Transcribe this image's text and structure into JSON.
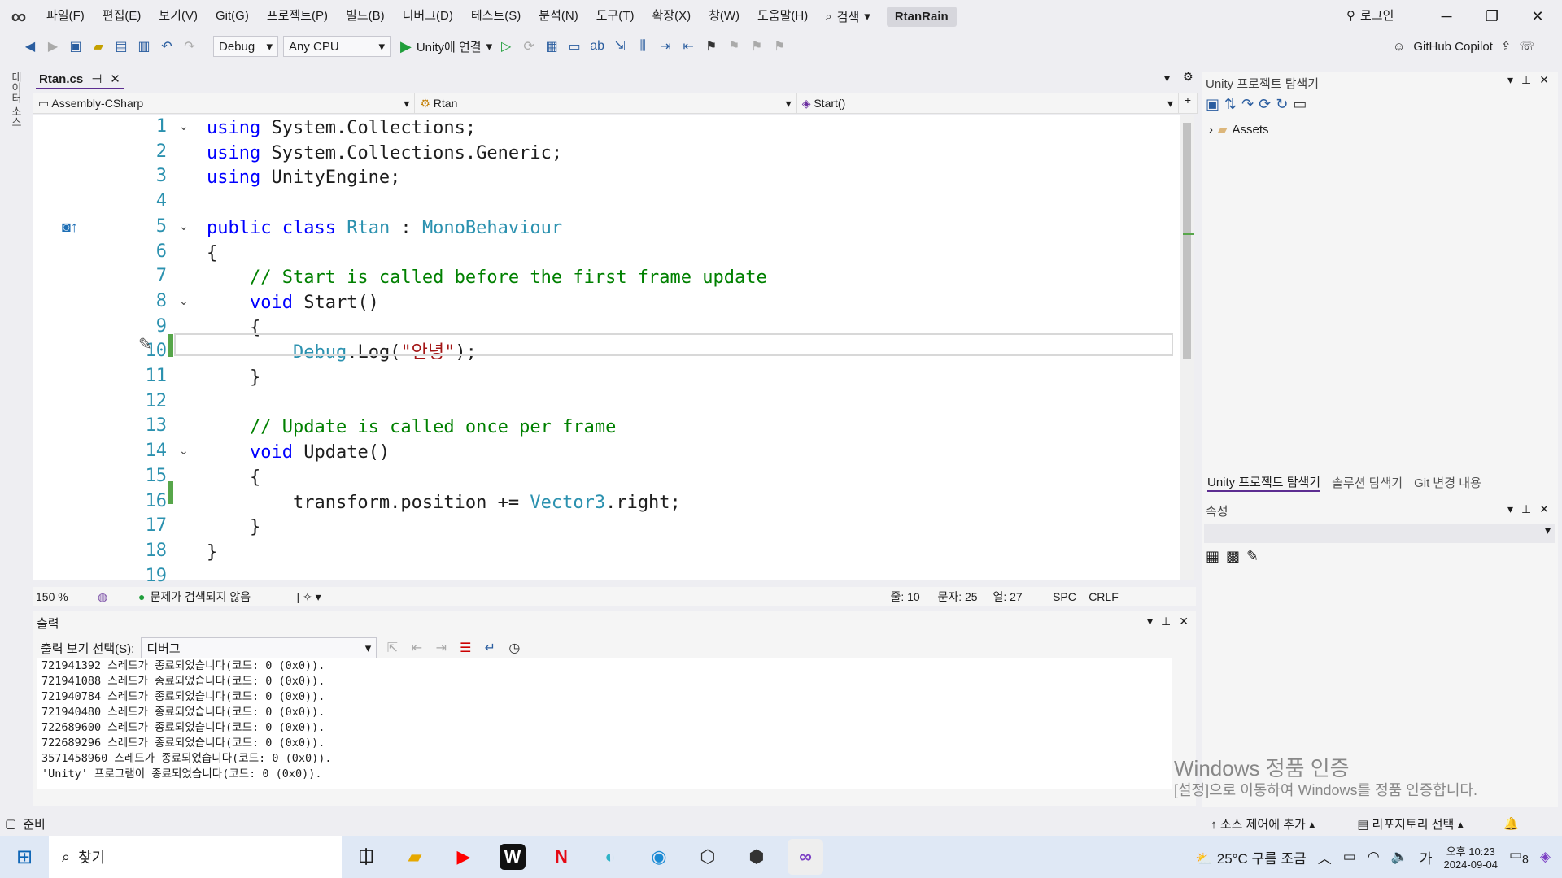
{
  "menu": {
    "items": [
      "파일(F)",
      "편집(E)",
      "보기(V)",
      "Git(G)",
      "프로젝트(P)",
      "빌드(B)",
      "디버그(D)",
      "테스트(S)",
      "분석(N)",
      "도구(T)",
      "확장(X)",
      "창(W)",
      "도움말(H)"
    ],
    "search": "검색",
    "solution": "RtanRain",
    "login": "로그인"
  },
  "toolbar": {
    "config": "Debug",
    "platform": "Any CPU",
    "run": "Unity에 연결",
    "copilot": "GitHub Copilot"
  },
  "side_tab": "데이터 소스",
  "tabs": {
    "active": "Rtan.cs"
  },
  "navbar": {
    "project": "Assembly-CSharp",
    "class": "Rtan",
    "member": "Start()"
  },
  "code": [
    {
      "n": "1",
      "fold": "v",
      "html": "<span class='kw'>using</span> System.Collections;"
    },
    {
      "n": "2",
      "fold": "",
      "html": "<span class='kw'>using</span> System.Collections.Generic;"
    },
    {
      "n": "3",
      "fold": "",
      "html": "<span class='kw'>using</span> UnityEngine;"
    },
    {
      "n": "4",
      "fold": "",
      "html": ""
    },
    {
      "n": "5",
      "fold": "v",
      "html": "<span class='kw'>public class</span> <span class='ty'>Rtan</span> : <span class='ty'>MonoBehaviour</span>"
    },
    {
      "n": "6",
      "fold": "",
      "html": "{"
    },
    {
      "n": "7",
      "fold": "",
      "html": "    <span class='cm'>// Start is called before the first frame update</span>"
    },
    {
      "n": "8",
      "fold": "v",
      "html": "    <span class='kw'>void</span> Start()"
    },
    {
      "n": "9",
      "fold": "",
      "html": "    {"
    },
    {
      "n": "10",
      "fold": "",
      "html": "        <span class='ty'>Debug</span>.Log(<span class='st'>\"안녕\"</span>);"
    },
    {
      "n": "11",
      "fold": "",
      "html": "    }"
    },
    {
      "n": "12",
      "fold": "",
      "html": ""
    },
    {
      "n": "13",
      "fold": "",
      "html": "    <span class='cm'>// Update is called once per frame</span>"
    },
    {
      "n": "14",
      "fold": "v",
      "html": "    <span class='kw'>void</span> Update()"
    },
    {
      "n": "15",
      "fold": "",
      "html": "    {"
    },
    {
      "n": "16",
      "fold": "",
      "html": "        transform.position += <span class='ty'>Vector3</span>.right;"
    },
    {
      "n": "17",
      "fold": "",
      "html": "    }"
    },
    {
      "n": "18",
      "fold": "",
      "html": "}"
    },
    {
      "n": "19",
      "fold": "",
      "html": ""
    }
  ],
  "editor_status": {
    "zoom": "150 %",
    "issues": "문제가 검색되지 않음",
    "line": "줄: 10",
    "char": "문자: 25",
    "col": "열: 27",
    "spc": "SPC",
    "crlf": "CRLF"
  },
  "output": {
    "title": "출력",
    "source_label": "출력 보기 선택(S):",
    "source": "디버그",
    "lines": "721941392 스레드가 종료되었습니다(코드: 0 (0x0)).\n721941088 스레드가 종료되었습니다(코드: 0 (0x0)).\n721940784 스레드가 종료되었습니다(코드: 0 (0x0)).\n721940480 스레드가 종료되었습니다(코드: 0 (0x0)).\n722689600 스레드가 종료되었습니다(코드: 0 (0x0)).\n722689296 스레드가 종료되었습니다(코드: 0 (0x0)).\n3571458960 스레드가 종료되었습니다(코드: 0 (0x0)).\n'Unity' 프로그램이 종료되었습니다(코드: 0 (0x0))."
  },
  "right": {
    "explorer_title": "Unity 프로젝트 탐색기",
    "assets": "Assets",
    "tab1": "Unity 프로젝트 탐색기",
    "tab2": "솔루션 탐색기",
    "tab3": "Git 변경 내용",
    "props_title": "속성"
  },
  "status": {
    "ready": "준비",
    "source_control": "소스 제어에 추가",
    "repo": "리포지토리 선택"
  },
  "watermark": {
    "title": "Windows 정품 인증",
    "sub": "[설정]으로 이동하여 Windows를 정품 인증합니다."
  },
  "taskbar": {
    "search": "찾기",
    "weather": "25°C 구름 조금",
    "ime": "가",
    "time": "오후 10:23",
    "date": "2024-09-04",
    "notif": "8"
  }
}
